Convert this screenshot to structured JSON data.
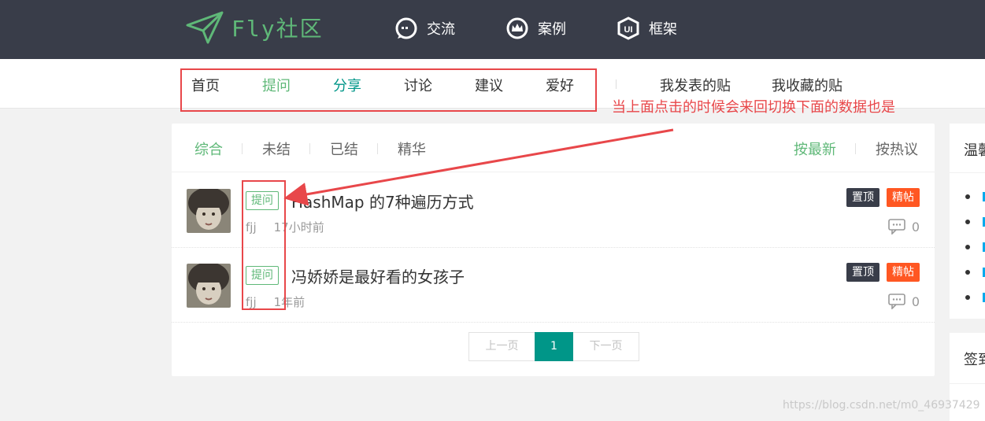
{
  "header": {
    "logo_text": "Fly社区",
    "nav": [
      {
        "label": "交流",
        "icon": "chat-icon"
      },
      {
        "label": "案例",
        "icon": "crown-icon"
      },
      {
        "label": "框架",
        "icon": "ui-shield-icon"
      }
    ]
  },
  "subnav": {
    "items": [
      "首页",
      "提问",
      "分享",
      "讨论",
      "建议",
      "爱好"
    ],
    "user_links": [
      "我发表的贴",
      "我收藏的贴"
    ]
  },
  "annotation": {
    "text": "当上面点击的时候会来回切换下面的数据也是"
  },
  "filters": {
    "left": [
      "综合",
      "未结",
      "已结",
      "精华"
    ],
    "right": [
      "按最新",
      "按热议"
    ]
  },
  "posts": [
    {
      "badge": "提问",
      "title": "HashMap 的7种遍历方式",
      "author": "fjj",
      "time": "17小时前",
      "tag_top": "置顶",
      "tag_hot": "精帖",
      "replies": "0"
    },
    {
      "badge": "提问",
      "title": "冯娇娇是最好看的女孩子",
      "author": "fjj",
      "time": "1年前",
      "tag_top": "置顶",
      "tag_hot": "精帖",
      "replies": "0"
    }
  ],
  "pager": {
    "prev": "上一页",
    "current": "1",
    "next": "下一页"
  },
  "sidebar": {
    "box1_title": "温馨",
    "box2_title": "签到"
  },
  "watermark": "https://blog.csdn.net/m0_46937429",
  "colors": {
    "header_bg": "#393d49",
    "brand_green": "#5FB878",
    "teal": "#009688",
    "hot_orange": "#ff5722",
    "annotation_red": "#e8474a"
  }
}
